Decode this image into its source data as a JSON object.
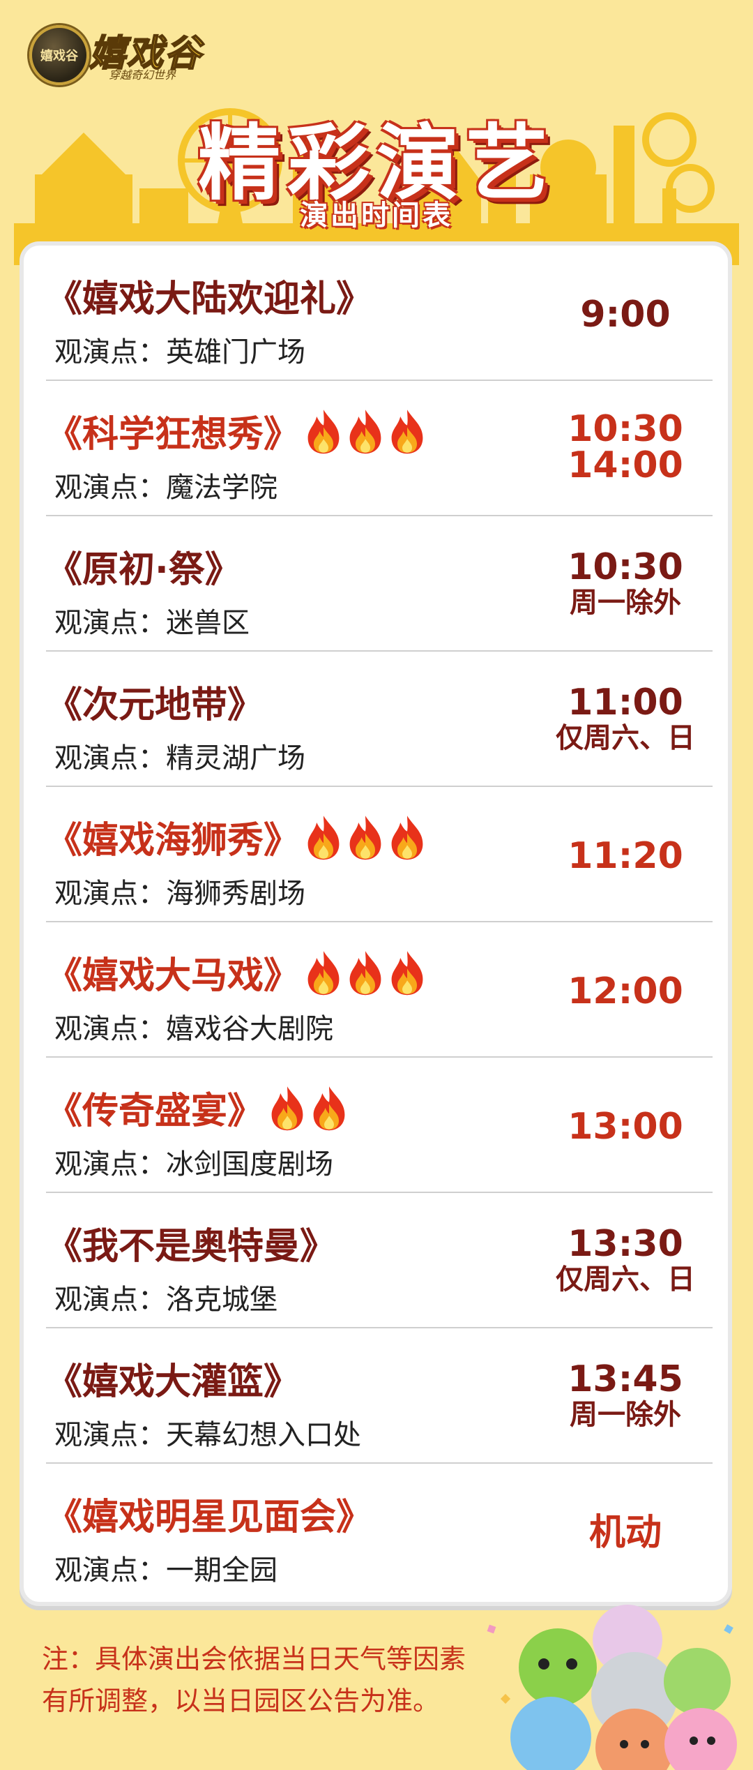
{
  "brand": {
    "badge_text": "嬉戏谷",
    "name": "嬉戏谷",
    "slogan": "穿越奇幻世界"
  },
  "header": {
    "title": "精彩演艺",
    "subtitle": "演出时间表"
  },
  "venue_prefix": "观演点：",
  "shows": [
    {
      "name": "《嬉戏大陆欢迎礼》",
      "venue": "英雄门广场",
      "times": [
        "9:00"
      ],
      "note": "",
      "flames": 0
    },
    {
      "name": "《科学狂想秀》",
      "venue": "魔法学院",
      "times": [
        "10:30",
        "14:00"
      ],
      "note": "",
      "flames": 3
    },
    {
      "name": "《原初·祭》",
      "venue": "迷兽区",
      "times": [
        "10:30"
      ],
      "note": "周一除外",
      "flames": 0
    },
    {
      "name": "《次元地带》",
      "venue": "精灵湖广场",
      "times": [
        "11:00"
      ],
      "note": "仅周六、日",
      "flames": 0
    },
    {
      "name": "《嬉戏海狮秀》",
      "venue": "海狮秀剧场",
      "times": [
        "11:20"
      ],
      "note": "",
      "flames": 3
    },
    {
      "name": "《嬉戏大马戏》",
      "venue": "嬉戏谷大剧院",
      "times": [
        "12:00"
      ],
      "note": "",
      "flames": 3
    },
    {
      "name": "《传奇盛宴》",
      "venue": "冰剑国度剧场",
      "times": [
        "13:00"
      ],
      "note": "",
      "flames": 2
    },
    {
      "name": "《我不是奥特曼》",
      "venue": "洛克城堡",
      "times": [
        "13:30"
      ],
      "note": "仅周六、日",
      "flames": 0
    },
    {
      "name": "《嬉戏大灌篮》",
      "venue": "天幕幻想入口处",
      "times": [
        "13:45"
      ],
      "note": "周一除外",
      "flames": 0
    },
    {
      "name": "《嬉戏明星见面会》",
      "venue": "一期全园",
      "times": [
        "机动"
      ],
      "note": "",
      "flames": 0
    }
  ],
  "footnote": {
    "line1": "注：具体演出会依据当日天气等因素",
    "line2": "有所调整，以当日园区公告为准。"
  },
  "colors": {
    "background": "#fbe79a",
    "accent_red": "#c7311a",
    "dark_red": "#7a1a14",
    "skyline": "#f5c52a"
  }
}
